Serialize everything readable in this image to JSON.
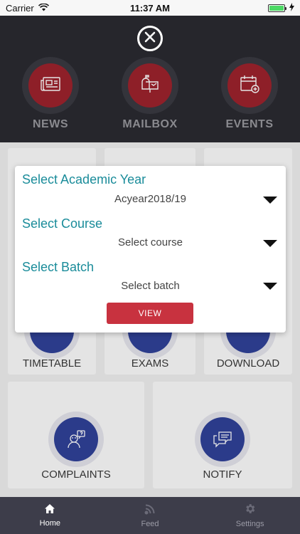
{
  "status": {
    "carrier": "Carrier",
    "time": "11:37 AM"
  },
  "top_menu": {
    "items": [
      {
        "label": "NEWS",
        "icon": "newspaper-icon"
      },
      {
        "label": "MAILBOX",
        "icon": "mailbox-icon"
      },
      {
        "label": "EVENTS",
        "icon": "calendar-add-icon"
      }
    ]
  },
  "grid": {
    "tiles": [
      {
        "label": "TIMETABLE",
        "icon": "timetable-icon"
      },
      {
        "label": "EXAMS",
        "icon": "exams-icon"
      },
      {
        "label": "DOWNLOAD",
        "icon": "download-icon"
      },
      {
        "label": "COMPLAINTS",
        "icon": "complaints-icon"
      },
      {
        "label": "NOTIFY",
        "icon": "chat-icon"
      }
    ]
  },
  "modal": {
    "academic_year_title": "Select Academic Year",
    "academic_year_value": "Acyear2018/19",
    "course_title": "Select Course",
    "course_value": "Select course",
    "batch_title": "Select Batch",
    "batch_value": "Select batch",
    "view_label": "VIEW"
  },
  "tabs": [
    {
      "label": "Home",
      "icon": "home-icon",
      "active": true
    },
    {
      "label": "Feed",
      "icon": "rss-icon",
      "active": false
    },
    {
      "label": "Settings",
      "icon": "gear-icon",
      "active": false
    }
  ],
  "colors": {
    "accent_red": "#c8323f",
    "teal": "#1a8c9a",
    "tile_blue": "#2b3b8a",
    "dark_bg": "#26262c"
  }
}
